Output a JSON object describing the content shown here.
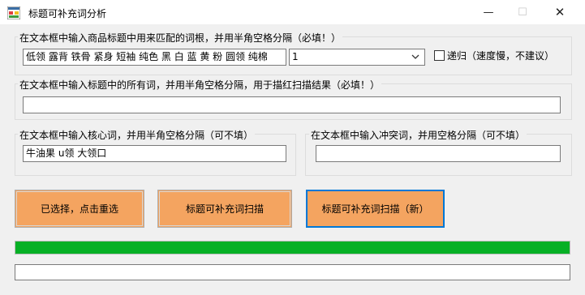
{
  "window": {
    "title": "标题可补充词分析",
    "minimize_glyph": "—",
    "maximize_glyph": "☐",
    "close_glyph": "✕"
  },
  "group_roots": {
    "label": "在文本框中输入商品标题中用来匹配的词根，并用半角空格分隔（必填！）",
    "input_value": "低领 露背 铁骨 紧身 短袖 纯色 黑 白 蓝 黄 粉 圆领 纯棉",
    "combo_value": "1",
    "checkbox_label": "递归（速度慢，不建议）",
    "checkbox_checked": false
  },
  "group_all_words": {
    "label": "在文本框中输入标题中的所有词，并用半角空格分隔，用于描红扫描结果（必填！）",
    "input_value": ""
  },
  "group_core": {
    "label": "在文本框中输入核心词，并用半角空格分隔（可不填）",
    "input_value": "牛油果 u领 大领口"
  },
  "group_conflict": {
    "label": "在文本框中输入冲突词，并用空格分隔（可不填）",
    "input_value": ""
  },
  "buttons": {
    "reselect": "已选择，点击重选",
    "scan": "标题可补充词扫描",
    "scan_new": "标题可补充词扫描（新）"
  },
  "progress": {
    "percent": 100,
    "color": "#06b025"
  },
  "status": {
    "value": ""
  },
  "colors": {
    "button": "#f4a460",
    "focus": "#0078d7",
    "background": "#f0f0f0"
  }
}
